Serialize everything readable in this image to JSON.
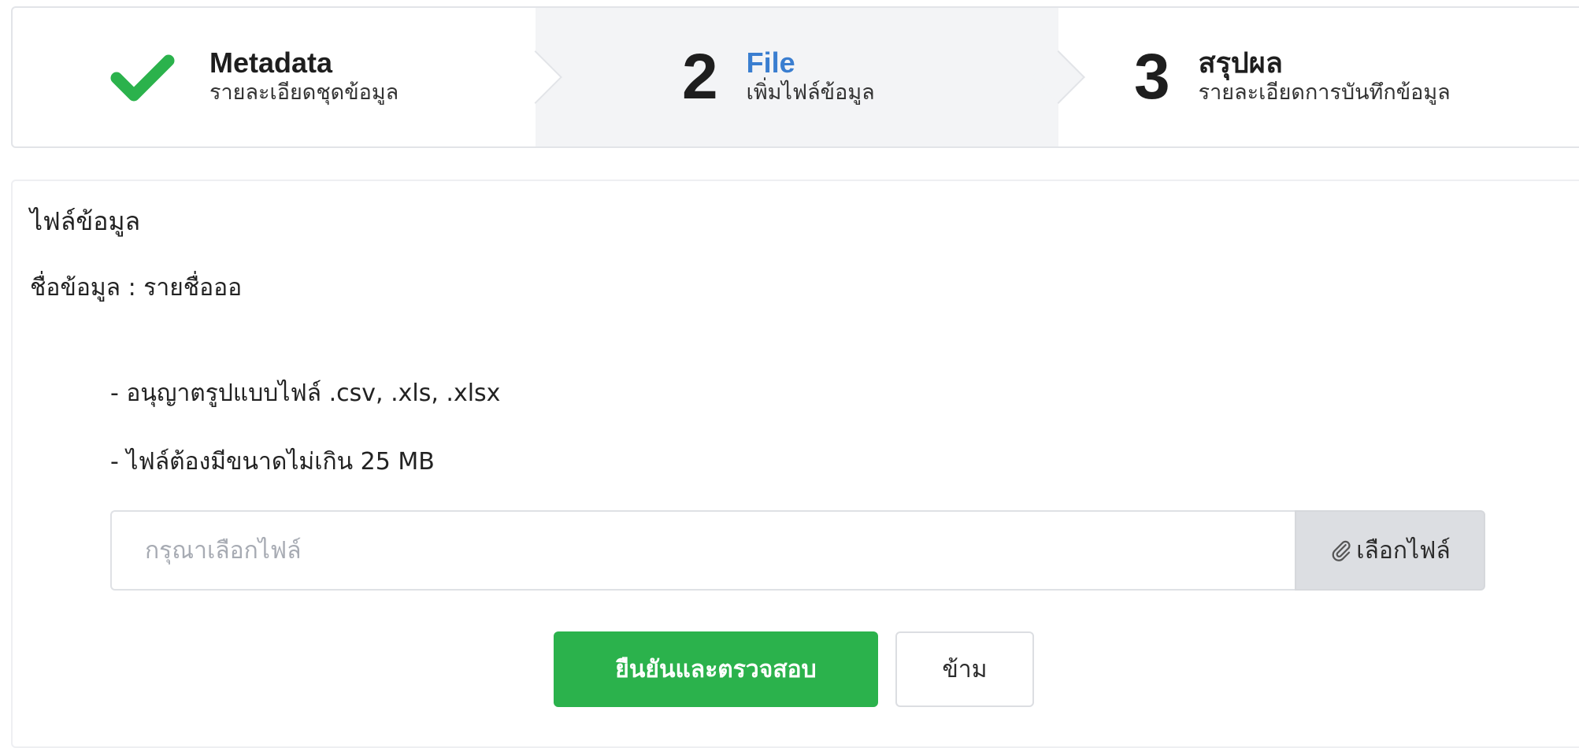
{
  "steps": [
    {
      "status": "completed",
      "icon": "check-icon",
      "title": "Metadata",
      "subtitle": "รายละเอียดชุดข้อมูล"
    },
    {
      "status": "active",
      "number": "2",
      "title": "File",
      "subtitle": "เพิ่มไฟล์ข้อมูล"
    },
    {
      "status": "pending",
      "number": "3",
      "title": "สรุปผล",
      "subtitle": "รายละเอียดการบันทึกข้อมูล"
    }
  ],
  "colors": {
    "check": "#2bb24c",
    "active_title": "#3a7ed0",
    "confirm_button": "#2bb24c"
  },
  "file_section": {
    "title": "ไฟล์ข้อมูล",
    "dataset_name_line": "ชื่อข้อมูล : รายชื่อออ",
    "rules": [
      "- อนุญาตรูปแบบไฟล์ .csv, .xls, .xlsx",
      "- ไฟล์ต้องมีขนาดไม่เกิน 25 MB"
    ],
    "file_input": {
      "placeholder": "กรุณาเลือกไฟล์",
      "value": ""
    },
    "browse_button": {
      "icon": "paperclip-icon",
      "label": "เลือกไฟล์"
    }
  },
  "actions": {
    "confirm_label": "ยืนยันและตรวจสอบ",
    "skip_label": "ข้าม"
  }
}
